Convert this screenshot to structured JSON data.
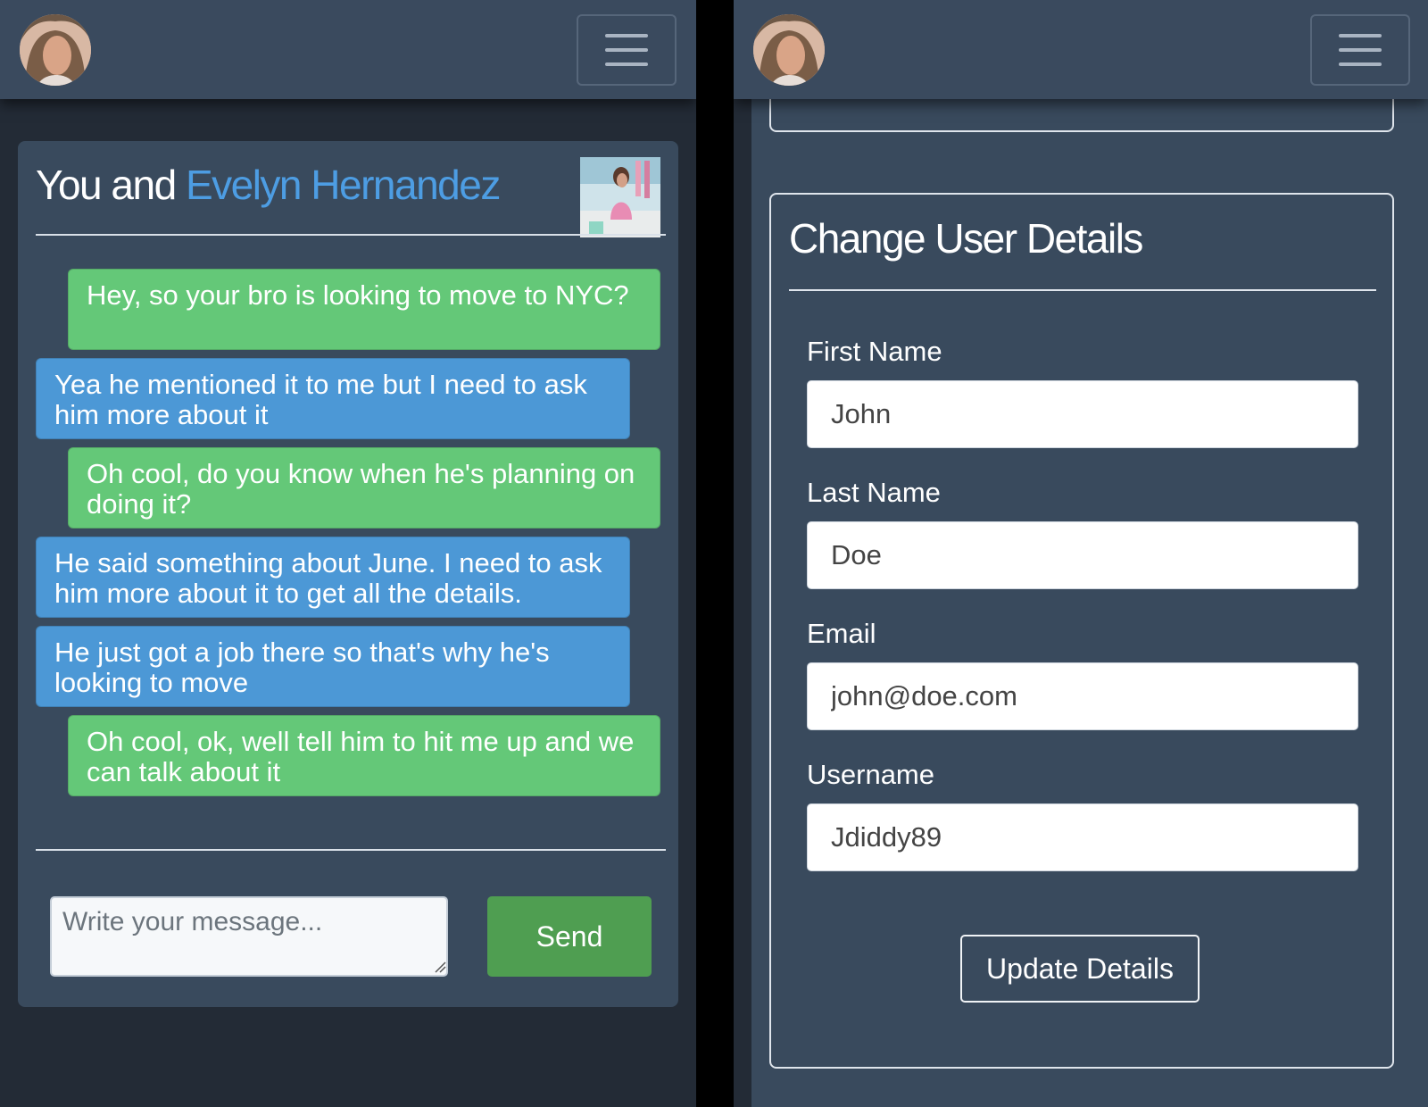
{
  "chat": {
    "title_prefix": "You and",
    "contact_name": "Evelyn Hernandez",
    "messages": [
      {
        "from": "me",
        "text": "Hey, so your bro is looking to move to NYC?"
      },
      {
        "from": "them",
        "text": "Yea he mentioned it to me but I need to ask him more about it"
      },
      {
        "from": "me",
        "text": "Oh cool, do you know when he's planning on doing it?"
      },
      {
        "from": "them",
        "text": "He said something about June. I need to ask him more about it to get all the details."
      },
      {
        "from": "them",
        "text": "He just got a job there so that's why he's looking to move"
      },
      {
        "from": "me",
        "text": "Oh cool, ok, well tell him to hit me up and we can talk about it"
      }
    ],
    "composer_placeholder": "Write your message...",
    "send_label": "Send"
  },
  "settings": {
    "title": "Change User Details",
    "fields": [
      {
        "label": "First Name",
        "value": "John"
      },
      {
        "label": "Last Name",
        "value": "Doe"
      },
      {
        "label": "Email",
        "value": "john@doe.com"
      },
      {
        "label": "Username",
        "value": "Jdiddy89"
      }
    ],
    "submit_label": "Update Details"
  },
  "colors": {
    "navbar": "#3a4a5e",
    "card": "#394a5d",
    "page_bg": "#232b36",
    "my_bubble": "#64c878",
    "their_bubble": "#4c98d6",
    "accent_name": "#4d9de3",
    "send_button": "#4f9e51"
  },
  "icons": [
    "avatar",
    "hamburger-menu-icon",
    "contact-photo",
    "resize-grip-icon"
  ]
}
